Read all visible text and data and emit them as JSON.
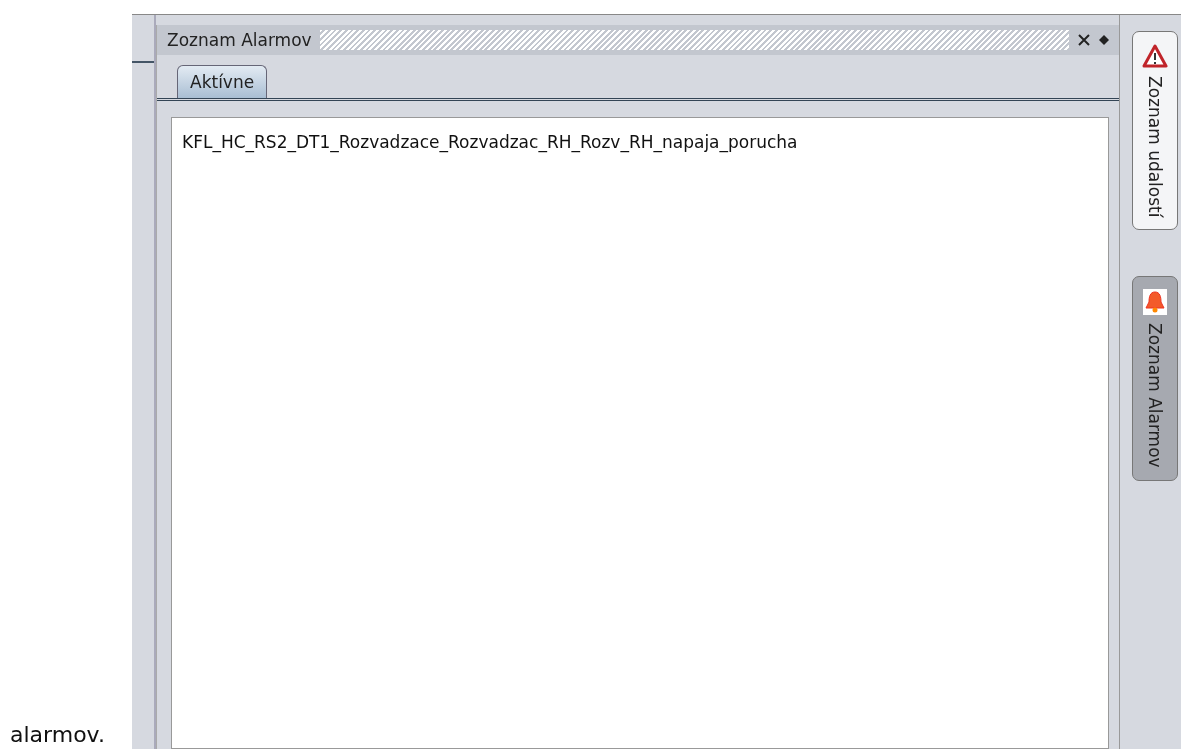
{
  "panel": {
    "title": "Zoznam Alarmov",
    "tabs": [
      {
        "label": "Aktívne",
        "selected": true
      }
    ],
    "items": [
      "KFL_HC_RS2_DT1_Rozvadzace_Rozvadzac_RH_Rozv_RH_napaja_porucha"
    ]
  },
  "side_tabs": [
    {
      "label": "Zoznam udalostí",
      "kind": "warning",
      "selected": false
    },
    {
      "label": "Zoznam Alarmov",
      "kind": "bell",
      "selected": true
    }
  ],
  "caption": "alarmov."
}
